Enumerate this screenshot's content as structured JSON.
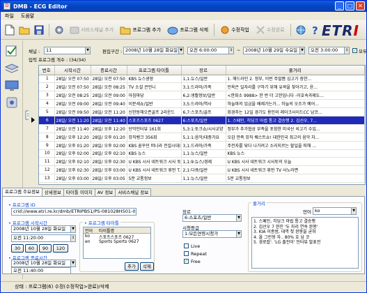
{
  "window": {
    "title": "DMB - ECG Editor",
    "app_icon_text": "D",
    "minimize": "_",
    "maximize": "□",
    "close": "✕"
  },
  "menu": [
    "파일",
    "도움말"
  ],
  "toolbar": {
    "add_service_channel": "서비스채널 추가",
    "add_program": "프로그램 추가",
    "delete_program": "프로그램 삭제",
    "edit_complete": "수정작업",
    "delete_disabled": "수정완료"
  },
  "brand": {
    "main": "ETR",
    "accent": "I"
  },
  "filters": {
    "channel_label": "채널 :",
    "channel_value": "11",
    "count_label": "입력 프로그램 개수 : (34/34)",
    "edit_period_label": "편집구간 :",
    "start_date": "2008년 10월 28일 화요일",
    "start_time": "오전 6:00:00",
    "tilde": "~",
    "end_date": "2008년 10월 29일 수요일",
    "end_time": "오전 3:00:00",
    "show_all": "모두표시"
  },
  "table": {
    "headers": [
      "번호",
      "시작시간",
      "종료시간",
      "프로그램 타이틀",
      "장르",
      "줄거리"
    ],
    "rows": [
      [
        "1",
        "28일/ 오전 07:50",
        "28일/ 오전 07:50",
        "KBS 뉴스광장",
        "1,1:뉴스/일반",
        "1. 해드라인      2. 정부, 이번 주말쯤 심고가 장한..."
      ],
      [
        "2",
        "28일/ 오전 07:50",
        "28일/ 오전 08:25",
        "TV 소설 큰언니",
        "3,1:드라마/가족",
        "민옥은 일자리를 구하기 위해 유곽을 찾아가고, 윤..."
      ],
      [
        "3",
        "28일/ 오전 08:25",
        "28일/ 오전 09:00",
        "아침마당",
        "6,2:생활정보/일반",
        "<한화소 9988> 한 번 더 고한입니다 -이호숙과제도..."
      ],
      [
        "4",
        "28일/ 오전 09:00",
        "28일/ 오전 09:40",
        "이문세쇼/일반",
        "3,5:드라마/역사",
        "하늘마저 임금을 배제가는가... 하늘의 오조가 예어..."
      ],
      [
        "5",
        "28일/ 오전 09:50",
        "28일/ 오전 11:20",
        "신한동해오픈골프 2라운드",
        "6,7:스포츠/골프",
        "회경주는 12일 경기도 용인의 레이크사이드CC 남코..."
      ],
      [
        "6",
        "28일/ 오전 11:20",
        "28일/ 오전 11:40",
        "스포츠스포츠 0627",
        "6:스포츠/일반",
        "1. 스페인, 히딩크 마법 통고 결승행      2. 김선우, 7..."
      ],
      [
        "7",
        "28일/ 오전 11:40",
        "28일/ 오후 12:20",
        "단막인터뷰 161회",
        "5,3:1:토크쇼/시사교양",
        "정부가 추가협상 부족을 포함한 미국산 쇠고기 수입..."
      ],
      [
        "8",
        "28일/ 오후 12:20",
        "28일/ 오후 01:20",
        "뮤직뱅크 356회",
        "5,1:1:음악/대중가요",
        "오감 만족 뮤직 퀘스트쇼! 대한민국 최고의 음악 차..."
      ],
      [
        "9",
        "28일/ 오후 01:20",
        "28일/ 오후 02:00",
        "KBS 꿈꾸던 떠나라 전설시대(...",
        "3,1:드라마/가족",
        "주전자를 닦다 나가려고 소리지르는 할일을 피해 ..."
      ],
      [
        "10",
        "28일/ 오후 02:00",
        "28일/ 오후 02:10",
        "KBS 뉴스",
        "1,1:뉴스/일반",
        "KBS 뉴스"
      ],
      [
        "11",
        "28일/ 오후 02:10",
        "28일/ 오후 02:30",
        "U KBS 시사 네트워크 시사 토...",
        "1,1:9:뉴스/경제",
        "U KBS 시사 네트워크      시사토의 오늘"
      ],
      [
        "12",
        "28일/ 오후 02:30",
        "28일/ 오후 03:00",
        "U KBS 시사 네트워크 휴먼 T...",
        "2,1:다큐/일반",
        "U KBS 시사 네트워크 휴먼 TV 사노라면"
      ],
      [
        "13",
        "28일/ 오후 03:00",
        "28일/ 오후 03:05",
        "5분 교통정보",
        "1,1:뉴스/일반",
        "5분 교통정보"
      ]
    ]
  },
  "tabs": [
    "프로그램 주요정보",
    "상세정보",
    "타이틀 이미지",
    "AV 정보",
    "서비스채널 정보"
  ],
  "panel": {
    "program_id_label": "• 프로그램 ID",
    "program_id_value": "crid://www.etri.re.kr/dmb/ETRIPBS1/PS-081028H501-03",
    "start_label": "• 프로그램 시작시간",
    "start_date": "2008년 10월 28일 화요일",
    "start_time": "오전 11:20:00",
    "quick_buttons": [
      "30",
      "60",
      "90",
      "120"
    ],
    "end_label": "• 프로그램 종료시간",
    "end_date": "2008년 10월 28일 화요일",
    "end_time": "오전 11:40:00",
    "title_group_label": "• 프로그램 타이틀",
    "title_headers": [
      "언어",
      "타이틀명"
    ],
    "titles": [
      [
        "ko",
        "스포츠스포츠 0627"
      ],
      [
        "en",
        "Sports Sports 0627"
      ]
    ],
    "add_button": "추가",
    "delete_button": "삭제",
    "genre_label": "장르",
    "genre_value": "6:스포츠/일반",
    "rating_label": "시청등급",
    "rating_value": "1:모든연령시청가",
    "live": "Live",
    "repeat": "Repeat",
    "free": "Free",
    "synopsis_label": "줄거리",
    "lang_label": "언어",
    "lang_value": "ko",
    "synopsis_lines": [
      "1. 스페인, 히딩크 마법 통고 결승행",
      "2. 김선우 7 현진 '두 자리 연속 완봉'",
      "3. KIA 이종범, 대역 첫 완봉을 굳혀",
      "4. 올 그린형 자.. 80% 호 남 코",
      "5. 경로잡'. 'LG 출전이' 인터뷰 발표전"
    ]
  },
  "status": "상태 : 프로그램(6) 수정(수정작업>완료)/삭제"
}
